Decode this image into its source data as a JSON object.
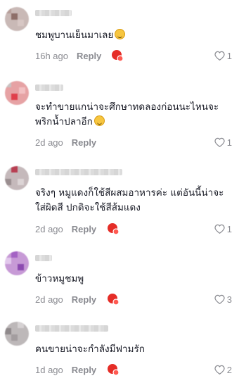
{
  "comments": [
    {
      "text": "ชมพูบานเย็นมาเลย",
      "emoji": "laughing-tears-emoji",
      "time": "16h ago",
      "reply": "Reply",
      "likes": "1"
    },
    {
      "text": "จะทำขายแกน่าจะศึกษาทดลองก่อนนะไหนจะ\nพริกน้ำปลาอีก",
      "emoji": "grinning-squint-emoji",
      "time": "2d ago",
      "reply": "Reply",
      "likes": "1"
    },
    {
      "text": "จริงๆ หมูแดงก็ใช้สีผสมอาหารค่ะ แต่อันนี้น่าจะ\nใส่ผิดสี ปกติจะใช้สีส้มแดง",
      "time": "2d ago",
      "reply": "Reply",
      "likes": "1"
    },
    {
      "text": "ข้าวหมูชมพู",
      "time": "2d ago",
      "reply": "Reply",
      "likes": "3"
    },
    {
      "text": "คนขายน่าจะกำลังมีฟามรัก",
      "time": "1d ago",
      "reply": "Reply",
      "likes": "2"
    }
  ],
  "colors": {
    "text": "#161823",
    "muted": "#8a8b91",
    "react_red": "#e52d27"
  }
}
